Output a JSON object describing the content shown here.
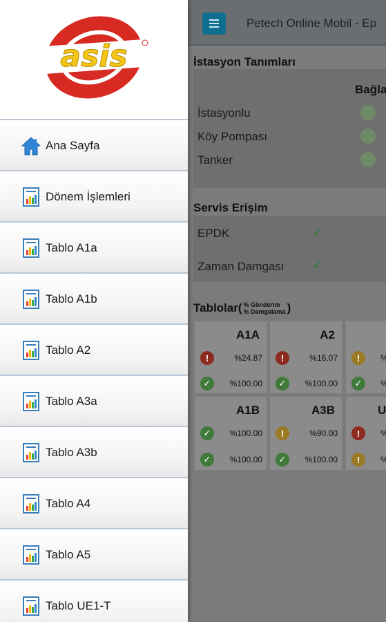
{
  "header": {
    "title": "Petech Online Mobil - Ep"
  },
  "drawer": {
    "logo_text": "asis",
    "items": [
      {
        "label": "Ana Sayfa",
        "icon": "home-icon"
      },
      {
        "label": "Dönem İşlemleri",
        "icon": "report-icon"
      },
      {
        "label": "Tablo A1a",
        "icon": "report-icon"
      },
      {
        "label": "Tablo A1b",
        "icon": "report-icon"
      },
      {
        "label": "Tablo A2",
        "icon": "report-icon"
      },
      {
        "label": "Tablo A3a",
        "icon": "report-icon"
      },
      {
        "label": "Tablo A3b",
        "icon": "report-icon"
      },
      {
        "label": "Tablo A4",
        "icon": "report-icon"
      },
      {
        "label": "Tablo A5",
        "icon": "report-icon"
      },
      {
        "label": "Tablo UE1-T",
        "icon": "report-icon"
      }
    ]
  },
  "stations": {
    "title": "İstasyon Tanımları",
    "column_header": "Bağla",
    "rows": [
      "İstasyonlu",
      "Köy Pompası",
      "Tanker"
    ]
  },
  "services": {
    "title": "Servis Erişim",
    "rows": [
      {
        "label": "EPDK",
        "status": "check"
      },
      {
        "label": "Zaman Damgası",
        "status": "check"
      }
    ]
  },
  "tables": {
    "title_prefix": "Tablolar(",
    "legend_line1": "% Gönderim",
    "legend_line2": "% Damgalama",
    "title_suffix": ")",
    "cards": [
      {
        "name": "A1A",
        "row1": {
          "status": "red",
          "value": "%24.87"
        },
        "row2": {
          "status": "green",
          "value": "%100.00"
        }
      },
      {
        "name": "A2",
        "row1": {
          "status": "red",
          "value": "%16.07"
        },
        "row2": {
          "status": "green",
          "value": "%100.00"
        }
      },
      {
        "name": "",
        "row1": {
          "status": "yellow",
          "value": "%"
        },
        "row2": {
          "status": "green",
          "value": "%1"
        }
      },
      {
        "name": "A1B",
        "row1": {
          "status": "green",
          "value": "%100.00"
        },
        "row2": {
          "status": "green",
          "value": "%100.00"
        }
      },
      {
        "name": "A3B",
        "row1": {
          "status": "yellow",
          "value": "%90.00"
        },
        "row2": {
          "status": "green",
          "value": "%100.00"
        }
      },
      {
        "name": "U",
        "row1": {
          "status": "red",
          "value": "%"
        },
        "row2": {
          "status": "yellow",
          "value": "%"
        }
      }
    ]
  },
  "colors": {
    "accent": "#0f6f8e",
    "logo_red": "#d62a22",
    "logo_yellow": "#f5c518"
  }
}
